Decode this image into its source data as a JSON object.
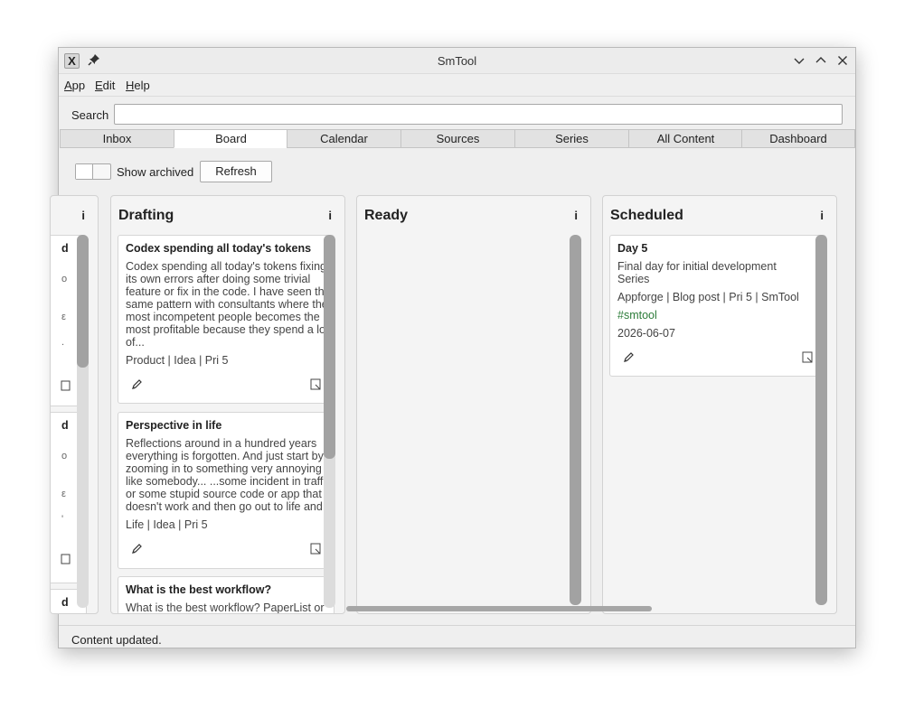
{
  "window": {
    "title": "SmTool",
    "app_icon_glyph": "X",
    "pin_glyph": "📌"
  },
  "menu": [
    {
      "mnemonic": "A",
      "rest": "pp"
    },
    {
      "mnemonic": "E",
      "rest": "dit"
    },
    {
      "mnemonic": "H",
      "rest": "elp"
    }
  ],
  "search": {
    "label": "Search",
    "value": "",
    "placeholder": ""
  },
  "tabs": [
    "Inbox",
    "Board",
    "Calendar",
    "Sources",
    "Series",
    "All Content",
    "Dashboard"
  ],
  "active_tab": "Board",
  "toolbar": {
    "show_archived_label": "Show archived",
    "show_archived_on": false,
    "refresh_label": "Refresh"
  },
  "board": {
    "info_glyph": "i",
    "partial_column": {
      "title_fragment": "d",
      "fragments": [
        "o",
        "ε",
        "."
      ],
      "card2_title_fragment": "d",
      "card2_fragments": [
        "o",
        "ε",
        "'"
      ],
      "card3_title_fragment": "d"
    },
    "columns": [
      {
        "title": "Drafting",
        "cards": [
          {
            "title": "Codex spending all today's tokens",
            "body": [
              "Codex spending all today's tokens fixing",
              "its own errors after doing some trivial",
              "feature or fix in the code. I have seen the",
              "same pattern with consultants where the",
              "most incompetent people becomes the",
              "most profitable because they spend a lot",
              "of..."
            ],
            "meta": "Product | Idea | Pri 5"
          },
          {
            "title": "Perspective in life",
            "body": [
              "Reflections around in a hundred years",
              "everything is forgotten. And just start by",
              "zooming in to something very annoying",
              "like somebody... ...some incident in traffic",
              "or some stupid source code or app that",
              "doesn't work and then go out to life and..."
            ],
            "meta": "Life | Idea | Pri 5"
          },
          {
            "title": "What is the best workflow?",
            "body": [
              "What is the best workflow? PaperList or"
            ],
            "meta": ""
          }
        ]
      },
      {
        "title": "Ready",
        "cards": []
      },
      {
        "title": "Scheduled",
        "cards": [
          {
            "title": "Day 5",
            "body": [
              "Final day for initial development",
              "Series"
            ],
            "meta": "Appforge | Blog post | Pri 5 | SmTool",
            "tag": "#smtool",
            "date": "2026-06-07"
          }
        ]
      }
    ]
  },
  "status": {
    "text": "Content updated."
  }
}
